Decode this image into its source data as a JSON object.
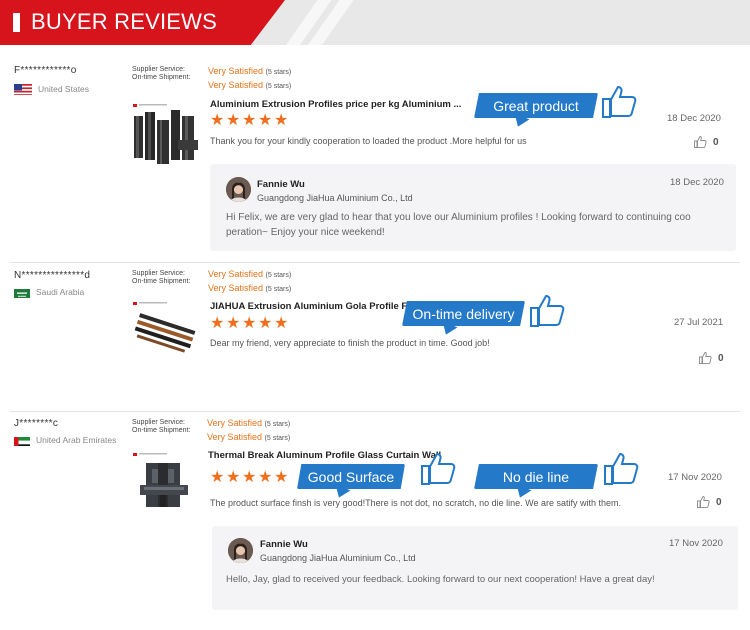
{
  "header": {
    "title": "BUYER REVIEWS"
  },
  "service_labels": {
    "supplier": "Supplier Service:",
    "shipment": "On-time Shipment:"
  },
  "rating_text": {
    "satisfied": "Very Satisfied",
    "stars_note": "(5 stars)"
  },
  "reviews": [
    {
      "buyer": "F************o",
      "country": "United States",
      "product_title": "Aluminium Extrusion Profiles price per kg Aluminium ...",
      "comment": "Thank you for your kindly cooperation to loaded the product .More helpful for us",
      "date": "18 Dec 2020",
      "likes": "0",
      "tags": [
        "Great product"
      ],
      "reply": {
        "name": "Fannie Wu",
        "company": "Guangdong JiaHua Aluminium Co., Ltd",
        "date": "18 Dec 2020",
        "text_line1": "Hi Felix, we are very glad to hear that you love our  Aluminium  profiles ! Looking forward to continuing coo",
        "text_line2": "peration~ Enjoy your nice weekend!"
      }
    },
    {
      "buyer": "N***************d",
      "country": "Saudi Arabia",
      "product_title": "JIAHUA Extrusion Aluminium Gola Profile For Kitchen",
      "comment": "Dear my friend, very appreciate to finish the product in time. Good job!",
      "date": "27 Jul 2021",
      "likes": "0",
      "tags": [
        "On-time delivery"
      ]
    },
    {
      "buyer": "J********c",
      "country": "United Arab Emirates",
      "product_title": "Thermal Break Aluminum Profile Glass Curtain Wall",
      "comment": "The product surface finsh is very good!There is not dot, no scratch, no die line. We are satify with them.",
      "date": "17 Nov 2020",
      "likes": "0",
      "tags": [
        "Good Surface",
        "No die line"
      ],
      "reply": {
        "name": "Fannie Wu",
        "company": "Guangdong JiaHua Aluminium Co., Ltd",
        "date": "17 Nov 2020",
        "text_line1": "Hello, Jay, glad to received your feedback. Looking forward to our next cooperation! Have a great day!"
      }
    }
  ],
  "colors": {
    "brand_red": "#d7141b",
    "accent_orange": "#f06f1e",
    "tag_blue": "#2479c9"
  },
  "icons": [
    "thumbs-up-icon",
    "star-icon",
    "flag-icon",
    "avatar"
  ]
}
